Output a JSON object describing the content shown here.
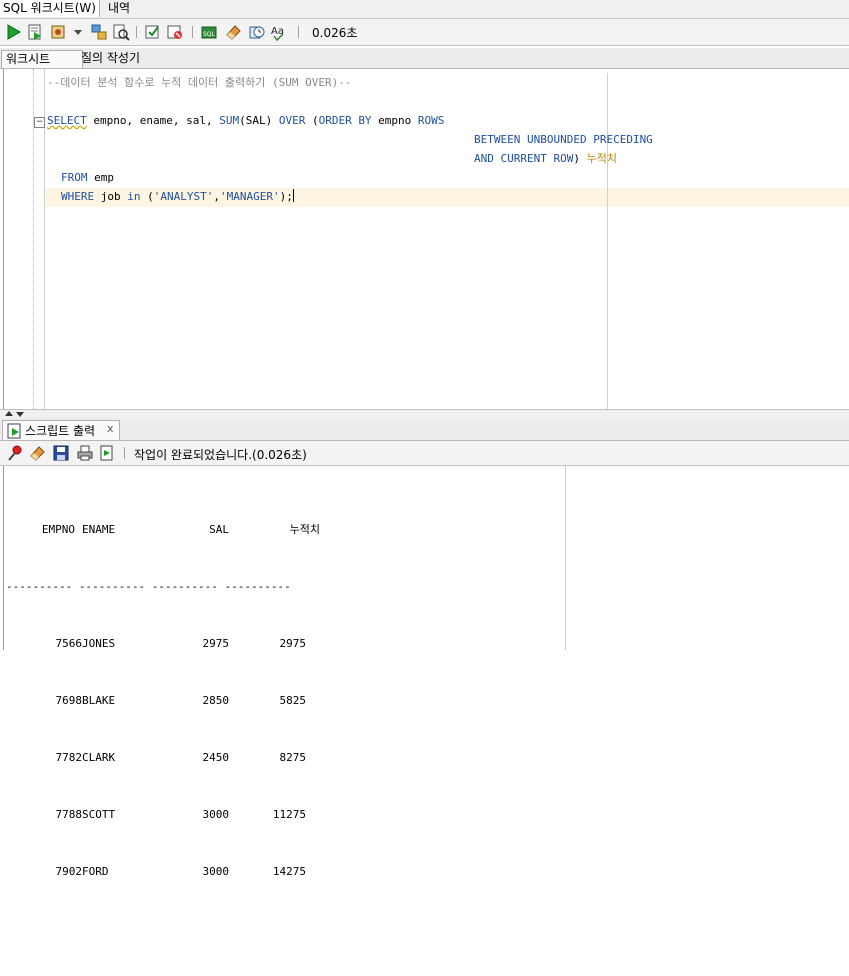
{
  "top_tabs": {
    "worksheet": "SQL 워크시트(W)",
    "history": "내역"
  },
  "toolbar": {
    "timing": "0.026초"
  },
  "sub_tabs": {
    "worksheet": "워크시트",
    "query_builder": "질의 작성기"
  },
  "editor": {
    "comment": "--데이터 분석 함수로 누적 데이터 출력하기 (SUM OVER)--",
    "line2": {
      "select": "SELECT",
      "cols": " empno, ename, sal, ",
      "sum": "SUM",
      "sal_arg": "(SAL) ",
      "over": "OVER",
      "paren": " (",
      "order_by": "ORDER BY",
      "empno": " empno ",
      "rows": "ROWS"
    },
    "line3": {
      "between": "BETWEEN UNBOUNDED PRECEDING"
    },
    "line4": {
      "and_current": "AND CURRENT ROW",
      "paren_close": ") ",
      "alias": "누적치"
    },
    "line5": {
      "from": "FROM",
      "table": " emp"
    },
    "line6": {
      "where": "WHERE",
      "job": " job ",
      "in": "in",
      "open": " (",
      "analyst": "'ANALYST'",
      "comma": ",",
      "manager": "'MANAGER'",
      "close": ");"
    }
  },
  "output_panel": {
    "tab_label": "스크립트 출력",
    "close": "x",
    "status": "작업이 완료되었습니다.(0.026초)"
  },
  "results": {
    "headers": {
      "empno": "EMPNO",
      "ename": "ENAME",
      "sal": "SAL",
      "cum": "누적치"
    },
    "separator": "---------- ---------- ---------- ----------",
    "rows": [
      {
        "empno": "7566",
        "ename": "JONES",
        "sal": "2975",
        "cum": "2975"
      },
      {
        "empno": "7698",
        "ename": "BLAKE",
        "sal": "2850",
        "cum": "5825"
      },
      {
        "empno": "7782",
        "ename": "CLARK",
        "sal": "2450",
        "cum": "8275"
      },
      {
        "empno": "7788",
        "ename": "SCOTT",
        "sal": "3000",
        "cum": "11275"
      },
      {
        "empno": "7902",
        "ename": "FORD",
        "sal": "3000",
        "cum": "14275"
      }
    ]
  }
}
